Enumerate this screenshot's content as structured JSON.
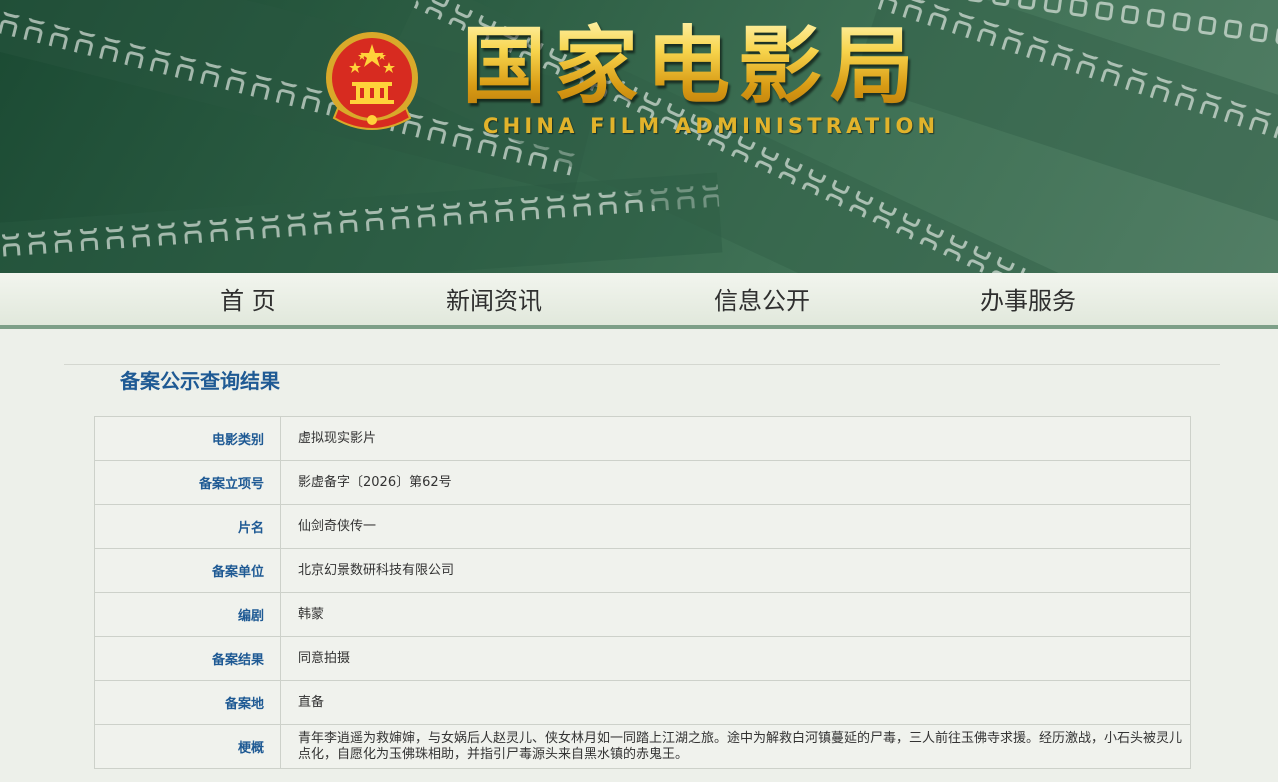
{
  "header": {
    "title_cn": "国家电影局",
    "title_en": "CHINA FILM ADMINISTRATION",
    "emblem_icon": "national-emblem-icon"
  },
  "nav": {
    "items": [
      {
        "label": "首 页"
      },
      {
        "label": "新闻资讯"
      },
      {
        "label": "信息公开"
      },
      {
        "label": "办事服务"
      }
    ]
  },
  "main": {
    "title": "备案公示查询结果",
    "rows": [
      {
        "label": "电影类别",
        "value": "虚拟现实影片"
      },
      {
        "label": "备案立项号",
        "value": "影虚备字〔2026〕第62号"
      },
      {
        "label": "片名",
        "value": "仙剑奇侠传一"
      },
      {
        "label": "备案单位",
        "value": "北京幻景数研科技有限公司"
      },
      {
        "label": "编剧",
        "value": "韩蒙"
      },
      {
        "label": "备案结果",
        "value": "同意拍摄"
      },
      {
        "label": "备案地",
        "value": "直备"
      },
      {
        "label": "梗概",
        "value": "青年李逍遥为救婶婶，与女娲后人赵灵儿、侠女林月如一同踏上江湖之旅。途中为解救白河镇蔓延的尸毒，三人前往玉佛寺求援。经历激战，小石头被灵儿点化，自愿化为玉佛珠相助，并指引尸毒源头来自黑水镇的赤鬼王。"
      }
    ]
  },
  "colors": {
    "banner_dark": "#1b4a33",
    "gold": "#f5cf47",
    "label_blue": "#1f5a94",
    "nav_border": "#7d9f88"
  }
}
